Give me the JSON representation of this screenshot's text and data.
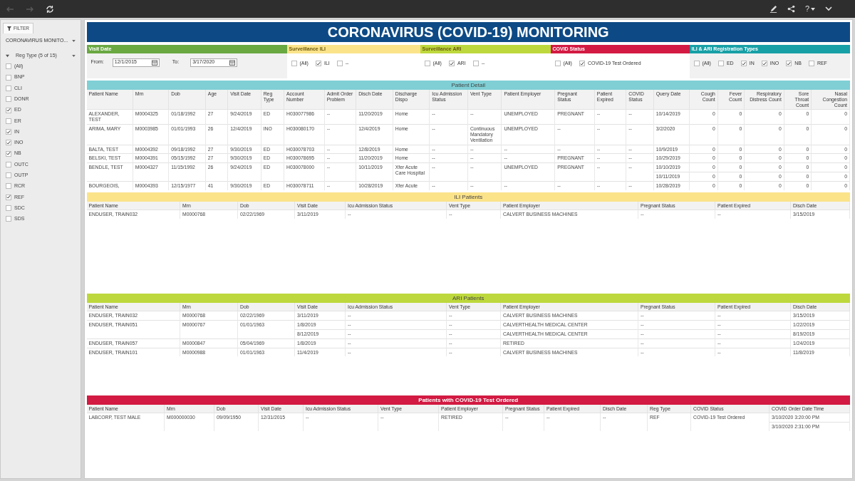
{
  "toolbar": {
    "nav_buttons": [
      {
        "kind": "back",
        "disabled": true
      },
      {
        "kind": "forward",
        "disabled": true
      },
      {
        "kind": "refresh",
        "disabled": false
      }
    ],
    "help_label": "?"
  },
  "sidebar": {
    "tab": "FILTER",
    "dashboard": "CORONAVIRUS MONITO...",
    "group": {
      "label": "Reg Type (5 of 15)",
      "expanded": true,
      "options": [
        {
          "label": "(All)",
          "checked": false
        },
        {
          "label": "BNP",
          "checked": false
        },
        {
          "label": "CLI",
          "checked": false
        },
        {
          "label": "DONR",
          "checked": false
        },
        {
          "label": "ED",
          "checked": true
        },
        {
          "label": "ER",
          "checked": false
        },
        {
          "label": "IN",
          "checked": true
        },
        {
          "label": "INO",
          "checked": true
        },
        {
          "label": "NB",
          "checked": true
        },
        {
          "label": "OUTC",
          "checked": false
        },
        {
          "label": "OUTP",
          "checked": false
        },
        {
          "label": "RCR",
          "checked": false
        },
        {
          "label": "REF",
          "checked": true
        },
        {
          "label": "SDC",
          "checked": false
        },
        {
          "label": "SDS",
          "checked": false
        }
      ]
    }
  },
  "title": "CORONAVIRUS (COVID-19) MONITORING",
  "filters": [
    {
      "kind": "date_range",
      "title": "Visit Date",
      "color": "#6aa842",
      "from_label": "From:",
      "from_value": "12/1/2015",
      "to_label": "To:",
      "to_value": "3/17/2020"
    },
    {
      "kind": "checkboxes",
      "title": "Surveillance ILI",
      "color": "#fbe38a",
      "options": [
        {
          "label": "(All)",
          "checked": false
        },
        {
          "label": "ILI",
          "checked": true
        },
        {
          "label": "--",
          "checked": false
        }
      ]
    },
    {
      "kind": "checkboxes",
      "title": "Surveillance ARI",
      "color": "#bdd83c",
      "options": [
        {
          "label": "(All)",
          "checked": false
        },
        {
          "label": "ARI",
          "checked": true
        },
        {
          "label": "--",
          "checked": false
        }
      ]
    },
    {
      "kind": "checkboxes",
      "title": "COVID Status",
      "color": "#d21a42",
      "options": [
        {
          "label": "(All)",
          "checked": false
        },
        {
          "label": "COVID-19 Test Ordered",
          "checked": true
        }
      ]
    },
    {
      "kind": "checkboxes",
      "title": "ILI & ARI Registration Types",
      "color": "#17a0a6",
      "options": [
        {
          "label": "(All)",
          "checked": false
        },
        {
          "label": "ED",
          "checked": false
        },
        {
          "label": "IN",
          "checked": true
        },
        {
          "label": "INO",
          "checked": true
        },
        {
          "label": "NB",
          "checked": true
        },
        {
          "label": "REF",
          "checked": false
        }
      ]
    }
  ],
  "sections": [
    {
      "title": "Patient Detail",
      "color": "#7fcfd5",
      "columns": [
        {
          "label": "Patient Name",
          "kind": "text"
        },
        {
          "label": "Mrn",
          "kind": "text"
        },
        {
          "label": "Dob",
          "kind": "text"
        },
        {
          "label": "Age",
          "kind": "text"
        },
        {
          "label": "Visit Date",
          "kind": "text"
        },
        {
          "label": "Reg Type",
          "kind": "text"
        },
        {
          "label": "Account Number",
          "kind": "text"
        },
        {
          "label": "Admit Order Problem",
          "kind": "text"
        },
        {
          "label": "Disch Date",
          "kind": "text"
        },
        {
          "label": "Discharge Dispo",
          "kind": "text"
        },
        {
          "label": "Icu Admission Status",
          "kind": "text"
        },
        {
          "label": "Vent Type",
          "kind": "text"
        },
        {
          "label": "Patient Employer",
          "kind": "text"
        },
        {
          "label": "Pregnant Status",
          "kind": "text"
        },
        {
          "label": "Patient Expired",
          "kind": "text"
        },
        {
          "label": "COVID Status",
          "kind": "text"
        },
        {
          "label": "Query Date",
          "kind": "text"
        },
        {
          "label": "Cough Count",
          "kind": "number"
        },
        {
          "label": "Fever Count",
          "kind": "number"
        },
        {
          "label": "Respiratory Distress Count",
          "kind": "number"
        },
        {
          "label": "Sore Throat Count",
          "kind": "number"
        },
        {
          "label": "Nasal Congestion Count",
          "kind": "number"
        }
      ],
      "rows": [
        [
          "ALEXANDER, TEST",
          "M0004325",
          "01/18/1992",
          "27",
          "9/24/2019",
          "ED",
          "H030077986",
          "--",
          "11/20/2019",
          "Home",
          "--",
          "--",
          "UNEMPLOYED",
          "PREGNANT",
          "--",
          "--",
          "10/14/2019",
          "0",
          "0",
          "0",
          "0",
          "0"
        ],
        [
          "ARIMA, MARY",
          "M0003985",
          "01/01/1993",
          "26",
          "12/4/2019",
          "INO",
          "H030080170",
          "--",
          "12/4/2019",
          "Home",
          "--",
          "Continuous Mandatory Ventilation",
          "UNEMPLOYED",
          "--",
          "--",
          "--",
          "3/2/2020",
          "0",
          "0",
          "0",
          "0",
          "0"
        ],
        [
          "BALTA, TEST",
          "M0004392",
          "09/18/1992",
          "27",
          "9/30/2019",
          "ED",
          "H030078703",
          "--",
          "12/8/2019",
          "Home",
          "--",
          "--",
          "--",
          "--",
          "--",
          "--",
          "10/9/2019",
          "0",
          "0",
          "0",
          "0",
          "0"
        ],
        [
          "BELSKI, TEST",
          "M0004391",
          "05/15/1992",
          "27",
          "9/30/2019",
          "ED",
          "H030078695",
          "--",
          "11/20/2019",
          "Home",
          "--",
          "--",
          "--",
          "PREGNANT",
          "--",
          "--",
          "10/29/2019",
          "0",
          "0",
          "0",
          "0",
          "0"
        ],
        [
          {
            "text": "BENDLE, TEST",
            "rowspan": 2
          },
          {
            "text": "M0004327",
            "rowspan": 2
          },
          {
            "text": "11/15/1992",
            "rowspan": 2
          },
          {
            "text": "26",
            "rowspan": 2
          },
          {
            "text": "9/24/2019",
            "rowspan": 2
          },
          {
            "text": "ED",
            "rowspan": 2
          },
          {
            "text": "H030078000",
            "rowspan": 2
          },
          {
            "text": "--",
            "rowspan": 2
          },
          {
            "text": "10/11/2019",
            "rowspan": 2
          },
          {
            "text": "Xfer Acute Care Hospital",
            "rowspan": 2
          },
          {
            "text": "--",
            "rowspan": 2
          },
          {
            "text": "--",
            "rowspan": 2
          },
          {
            "text": "UNEMPLOYED",
            "rowspan": 2
          },
          {
            "text": "PREGNANT",
            "rowspan": 2
          },
          {
            "text": "--",
            "rowspan": 2
          },
          {
            "text": "--",
            "rowspan": 2
          },
          "10/10/2019",
          "0",
          "0",
          "0",
          "0",
          "0"
        ],
        [
          "10/11/2019",
          "0",
          "0",
          "0",
          "0",
          "0"
        ],
        [
          "BOURGEOIS,",
          "M0004393",
          "12/15/1977",
          "41",
          "9/30/2019",
          "ED",
          "H030078711",
          "--",
          "10/28/2019",
          "Xfer Acute",
          "--",
          "--",
          "--",
          "--",
          "--",
          "--",
          "10/28/2019",
          "0",
          "0",
          "0",
          "0",
          "0"
        ]
      ]
    },
    {
      "title": "ILI Patients",
      "color": "#fbe38a",
      "columns": [
        {
          "label": "Patient Name",
          "kind": "text"
        },
        {
          "label": "Mrn",
          "kind": "text"
        },
        {
          "label": "Dob",
          "kind": "text"
        },
        {
          "label": "Visit Date",
          "kind": "text"
        },
        {
          "label": "Icu Admission Status",
          "kind": "text"
        },
        {
          "label": "Vent Type",
          "kind": "text"
        },
        {
          "label": "Patient Employer",
          "kind": "text"
        },
        {
          "label": "Pregnant Status",
          "kind": "text"
        },
        {
          "label": "Patient Expired",
          "kind": "text"
        },
        {
          "label": "Disch Date",
          "kind": "text"
        }
      ],
      "rows": [
        [
          "ENDUSER, TRAIN032",
          "M0000768",
          "02/22/1969",
          "3/11/2019",
          "--",
          "--",
          "CALVERT BUSINESS MACHINES",
          "--",
          "--",
          "3/15/2019"
        ]
      ]
    },
    {
      "title": "ARI Patients",
      "color": "#bdd83c",
      "columns": [
        {
          "label": "Patient Name",
          "kind": "text"
        },
        {
          "label": "Mrn",
          "kind": "text"
        },
        {
          "label": "Dob",
          "kind": "text"
        },
        {
          "label": "Visit Date",
          "kind": "text"
        },
        {
          "label": "Icu Admission Status",
          "kind": "text"
        },
        {
          "label": "Vent Type",
          "kind": "text"
        },
        {
          "label": "Patient Employer",
          "kind": "text"
        },
        {
          "label": "Pregnant Status",
          "kind": "text"
        },
        {
          "label": "Patient Expired",
          "kind": "text"
        },
        {
          "label": "Disch Date",
          "kind": "text"
        }
      ],
      "rows": [
        [
          "ENDUSER, TRAIN032",
          "M0000768",
          "02/22/1969",
          "3/11/2019",
          "--",
          "--",
          "CALVERT BUSINESS MACHINES",
          "--",
          "--",
          "3/15/2019"
        ],
        [
          {
            "text": "ENDUSER, TRAIN051",
            "rowspan": 2
          },
          {
            "text": "M0000767",
            "rowspan": 2
          },
          {
            "text": "01/01/1963",
            "rowspan": 2
          },
          "1/8/2019",
          "--",
          "--",
          "CALVERTHEALTH MEDICAL CENTER",
          "--",
          "--",
          "1/22/2019"
        ],
        [
          "8/12/2019",
          "--",
          "--",
          "CALVERTHEALTH MEDICAL CENTER",
          "--",
          "--",
          "8/19/2019"
        ],
        [
          "ENDUSER, TRAIN057",
          "M0000847",
          "05/04/1969",
          "1/8/2019",
          "--",
          "--",
          "RETIRED",
          "--",
          "--",
          "1/24/2019"
        ],
        [
          "ENDUSER, TRAIN101",
          "M0000988",
          "01/01/1963",
          "11/4/2019",
          "--",
          "--",
          "CALVERT BUSINESS MACHINES",
          "--",
          "--",
          "11/8/2019"
        ]
      ]
    },
    {
      "title": "Patients with COVID-19 Test Ordered",
      "color": "#d21a42",
      "columns": [
        {
          "label": "Patient Name",
          "kind": "text"
        },
        {
          "label": "Mrn",
          "kind": "text"
        },
        {
          "label": "Dob",
          "kind": "text"
        },
        {
          "label": "Visit Date",
          "kind": "text"
        },
        {
          "label": "Icu Admission Status",
          "kind": "text"
        },
        {
          "label": "Vent Type",
          "kind": "text"
        },
        {
          "label": "Patient Employer",
          "kind": "text"
        },
        {
          "label": "Pregnant Status",
          "kind": "text"
        },
        {
          "label": "Patient Expired",
          "kind": "text"
        },
        {
          "label": "Disch Date",
          "kind": "text"
        },
        {
          "label": "Reg Type",
          "kind": "text"
        },
        {
          "label": "COVID Status",
          "kind": "text"
        },
        {
          "label": "COVID Order Date Time",
          "kind": "text"
        }
      ],
      "rows": [
        [
          {
            "text": "LABCORP, TEST MALE",
            "rowspan": 2
          },
          {
            "text": "M000000030",
            "rowspan": 2
          },
          {
            "text": "09/09/1950",
            "rowspan": 2
          },
          {
            "text": "12/31/2015",
            "rowspan": 2
          },
          {
            "text": "--",
            "rowspan": 2
          },
          {
            "text": "--",
            "rowspan": 2
          },
          {
            "text": "RETIRED",
            "rowspan": 2
          },
          {
            "text": "--",
            "rowspan": 2
          },
          {
            "text": "--",
            "rowspan": 2
          },
          {
            "text": "--",
            "rowspan": 2
          },
          {
            "text": "REF",
            "rowspan": 2
          },
          {
            "text": "COVID-19 Test Ordered",
            "rowspan": 2
          },
          "3/10/2020 3:20:00 PM"
        ],
        [
          "3/10/2020 2:31:00 PM"
        ]
      ]
    }
  ]
}
